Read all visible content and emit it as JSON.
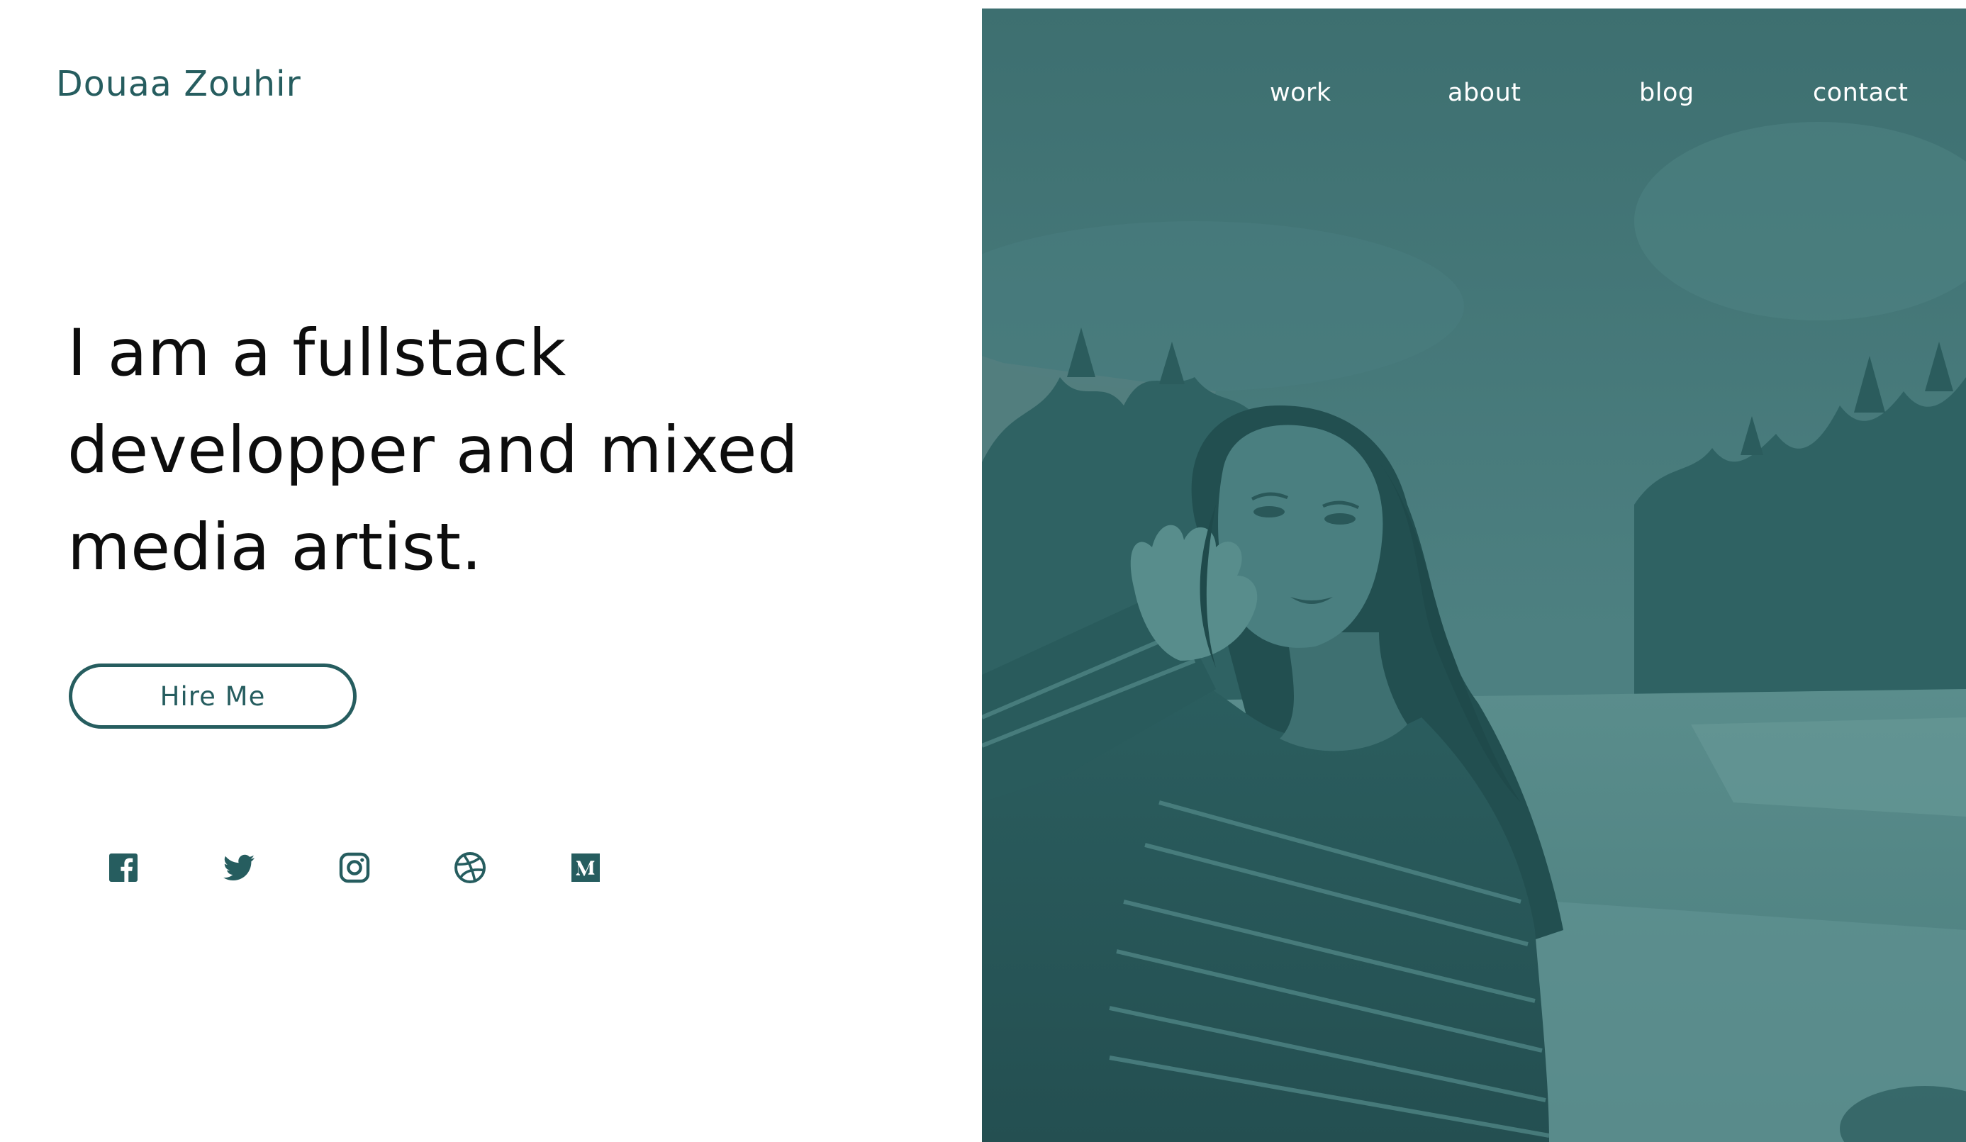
{
  "brand": {
    "name": "Douaa Zouhir"
  },
  "nav": {
    "items": [
      {
        "label": "work"
      },
      {
        "label": "about"
      },
      {
        "label": "blog"
      },
      {
        "label": "contact"
      }
    ]
  },
  "hero": {
    "headline_lines": [
      "I am a fullstack",
      "developper and mixed",
      "media artist."
    ],
    "cta_label": "Hire Me"
  },
  "social": [
    {
      "icon": "facebook-icon"
    },
    {
      "icon": "twitter-icon"
    },
    {
      "icon": "instagram-icon"
    },
    {
      "icon": "dribbble-icon"
    },
    {
      "icon": "medium-icon"
    }
  ],
  "colors": {
    "accent": "#265d5f",
    "photo_tint": "#46797a",
    "text": "#0d0d0d",
    "nav_text": "#ffffff"
  }
}
